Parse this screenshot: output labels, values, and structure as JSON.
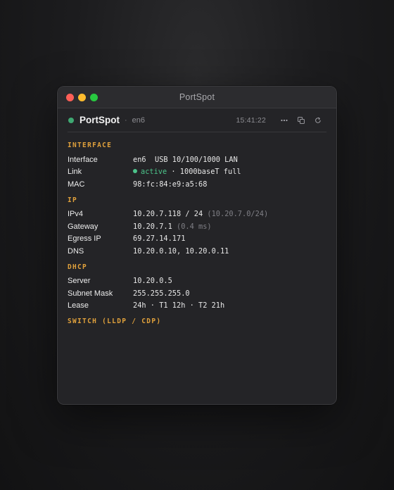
{
  "window": {
    "title": "PortSpot"
  },
  "header": {
    "app_name": "PortSpot",
    "separator": "·",
    "interface": "en6",
    "time": "15:41:22",
    "more_label": "···"
  },
  "sections": {
    "interface": {
      "title": "INTERFACE",
      "interface_label": "Interface",
      "interface_value": "en6  USB 10/100/1000 LAN",
      "link_label": "Link",
      "link_status": "active",
      "link_rest": " · 1000baseT full",
      "mac_label": "MAC",
      "mac_value": "98:fc:84:e9:a5:68"
    },
    "ip": {
      "title": "IP",
      "ipv4_label": "IPv4",
      "ipv4_value": "10.20.7.118 / 24",
      "ipv4_subnet": " (10.20.7.0/24)",
      "gateway_label": "Gateway",
      "gateway_value": "10.20.7.1",
      "gateway_latency": " (0.4 ms)",
      "egress_label": "Egress IP",
      "egress_value": "69.27.14.171",
      "dns_label": "DNS",
      "dns_value": "10.20.0.10, 10.20.0.11"
    },
    "dhcp": {
      "title": "DHCP",
      "server_label": "Server",
      "server_value": "10.20.0.5",
      "mask_label": "Subnet Mask",
      "mask_value": "255.255.255.0",
      "lease_label": "Lease",
      "lease_value": "24h · T1 12h · T2 21h"
    },
    "switch": {
      "title": "SWITCH (LLDP / CDP)"
    }
  },
  "colors": {
    "accent": "#e0a13c",
    "status_green": "#4cc38a",
    "close": "#fe5f57",
    "minimize": "#febc2e",
    "zoom": "#28c840"
  },
  "icons": {
    "more": "ellipsis-icon",
    "copy": "copy-icon",
    "refresh": "refresh-icon"
  }
}
